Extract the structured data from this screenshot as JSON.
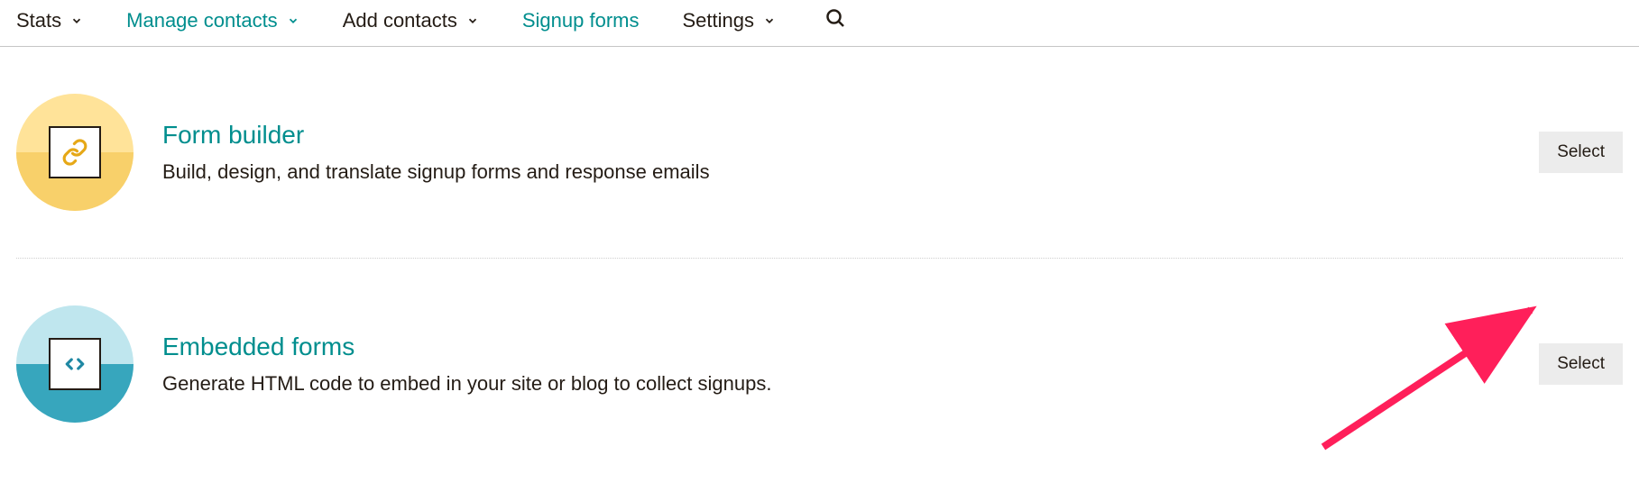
{
  "nav": {
    "items": [
      {
        "label": "Stats",
        "accent": false,
        "dropdown": true
      },
      {
        "label": "Manage contacts",
        "accent": true,
        "dropdown": true
      },
      {
        "label": "Add contacts",
        "accent": false,
        "dropdown": true
      },
      {
        "label": "Signup forms",
        "accent": true,
        "dropdown": false
      },
      {
        "label": "Settings",
        "accent": false,
        "dropdown": true
      }
    ]
  },
  "cards": [
    {
      "title": "Form builder",
      "description": "Build, design, and translate signup forms and response emails",
      "select_label": "Select",
      "icon": "link-icon",
      "theme": "yellow"
    },
    {
      "title": "Embedded forms",
      "description": "Generate HTML code to embed in your site or blog to collect signups.",
      "select_label": "Select",
      "icon": "code-icon",
      "theme": "blue"
    }
  ]
}
